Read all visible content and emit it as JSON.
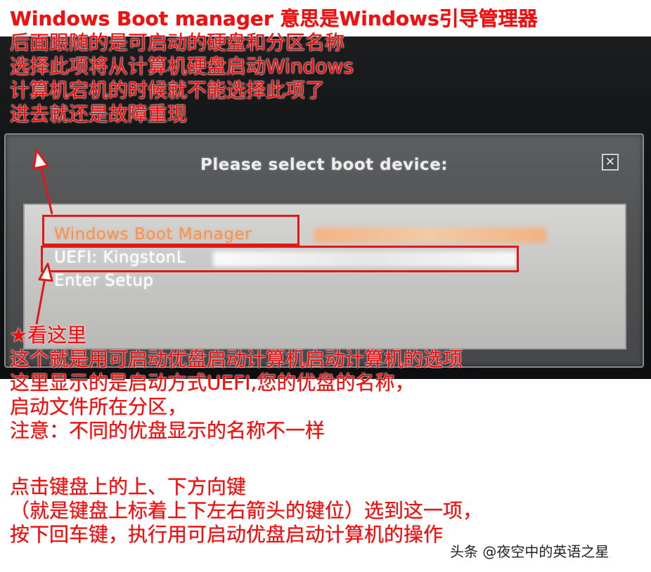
{
  "dialog": {
    "title": "Please select boot device:",
    "close_glyph": "✕",
    "items": [
      {
        "label": "Windows Boot Manager",
        "state": "selected"
      },
      {
        "label": "UEFI: KingstonL",
        "state": "normal"
      },
      {
        "label": "Enter Setup",
        "state": "normal"
      }
    ]
  },
  "annotations": {
    "top": [
      "Windows Boot manager 意思是Windows引导管理器",
      "后面跟随的是可启动的硬盘和分区名称",
      "选择此项将从计算机硬盘启动Windows",
      "计算机宕机的时候就不能选择此项了",
      "进去就还是故障重现"
    ],
    "middle": [
      "★看这里",
      "这个就是用可启动优盘启动计算机启动计算机的选项",
      "这里显示的是启动方式UEFI,您的优盘的名称，",
      "启动文件所在分区，",
      "注意：不同的优盘显示的名称不一样"
    ],
    "bottom": [
      "点击键盘上的上、下方向键",
      "（就是键盘上标着上下左右箭头的键位）选到这一项，",
      "按下回车键，执行用可启动优盘启动计算机的操作"
    ]
  },
  "watermark": "头条 @夜空中的英语之星",
  "colors": {
    "annotation_red": "#f01010",
    "highlight_red": "#e01818",
    "selected_item": "#f29456"
  }
}
